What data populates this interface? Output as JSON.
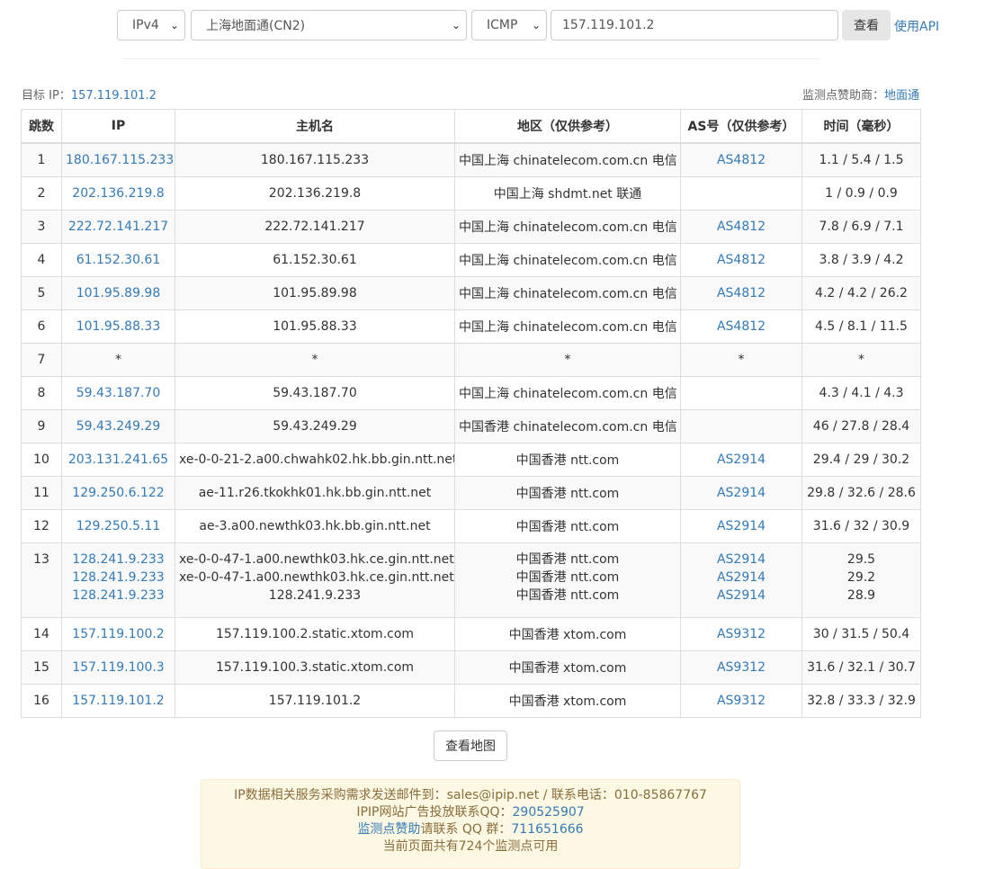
{
  "toolbar": {
    "ip_version": "IPv4",
    "node": "上海地面通(CN2)",
    "protocol": "ICMP",
    "target_value": "157.119.101.2",
    "query_label": "查看",
    "api_label": "使用API"
  },
  "info": {
    "target_label": "目标 IP：",
    "target_ip": "157.119.101.2",
    "sponsor_label": "监测点赞助商：",
    "sponsor_name": "地面通"
  },
  "table": {
    "headers": [
      "跳数",
      "IP",
      "主机名",
      "地区（仅供参考）",
      "AS号（仅供参考）",
      "时间（毫秒）"
    ],
    "rows": [
      {
        "hop": "1",
        "ip": "180.167.115.233",
        "host": "180.167.115.233",
        "region": "中国上海 chinatelecom.com.cn 电信",
        "asn": "AS4812",
        "time": "1.1 / 5.4 / 1.5"
      },
      {
        "hop": "2",
        "ip": "202.136.219.8",
        "host": "202.136.219.8",
        "region": "中国上海 shdmt.net 联通",
        "asn": "",
        "time": "1 / 0.9 / 0.9"
      },
      {
        "hop": "3",
        "ip": "222.72.141.217",
        "host": "222.72.141.217",
        "region": "中国上海 chinatelecom.com.cn 电信",
        "asn": "AS4812",
        "time": "7.8 / 6.9 / 7.1"
      },
      {
        "hop": "4",
        "ip": "61.152.30.61",
        "host": "61.152.30.61",
        "region": "中国上海 chinatelecom.com.cn 电信",
        "asn": "AS4812",
        "time": "3.8 / 3.9 / 4.2"
      },
      {
        "hop": "5",
        "ip": "101.95.89.98",
        "host": "101.95.89.98",
        "region": "中国上海 chinatelecom.com.cn 电信",
        "asn": "AS4812",
        "time": "4.2 / 4.2 / 26.2"
      },
      {
        "hop": "6",
        "ip": "101.95.88.33",
        "host": "101.95.88.33",
        "region": "中国上海 chinatelecom.com.cn 电信",
        "asn": "AS4812",
        "time": "4.5 / 8.1 / 11.5"
      },
      {
        "hop": "7",
        "ip": "*",
        "host": "*",
        "region": "*",
        "asn": "*",
        "time": "*"
      },
      {
        "hop": "8",
        "ip": "59.43.187.70",
        "host": "59.43.187.70",
        "region": "中国上海 chinatelecom.com.cn 电信",
        "asn": "",
        "time": "4.3 / 4.1 / 4.3"
      },
      {
        "hop": "9",
        "ip": "59.43.249.29",
        "host": "59.43.249.29",
        "region": "中国香港 chinatelecom.com.cn 电信",
        "asn": "",
        "time": "46 / 27.8 / 28.4"
      },
      {
        "hop": "10",
        "ip": "203.131.241.65",
        "host": "xe-0-0-21-2.a00.chwahk02.hk.bb.gin.ntt.net",
        "region": "中国香港 ntt.com",
        "asn": "AS2914",
        "time": "29.4 / 29 / 30.2"
      },
      {
        "hop": "11",
        "ip": "129.250.6.122",
        "host": "ae-11.r26.tkokhk01.hk.bb.gin.ntt.net",
        "region": "中国香港 ntt.com",
        "asn": "AS2914",
        "time": "29.8 / 32.6 / 28.6"
      },
      {
        "hop": "12",
        "ip": "129.250.5.11",
        "host": "ae-3.a00.newthk03.hk.bb.gin.ntt.net",
        "region": "中国香港 ntt.com",
        "asn": "AS2914",
        "time": "31.6 / 32 / 30.9"
      },
      {
        "hop": "13",
        "multi": [
          {
            "ip": "128.241.9.233",
            "host": "xe-0-0-47-1.a00.newthk03.hk.ce.gin.ntt.net",
            "region": "中国香港 ntt.com",
            "asn": "AS2914",
            "time": "29.5"
          },
          {
            "ip": "128.241.9.233",
            "host": "xe-0-0-47-1.a00.newthk03.hk.ce.gin.ntt.net",
            "region": "中国香港 ntt.com",
            "asn": "AS2914",
            "time": "29.2"
          },
          {
            "ip": "128.241.9.233",
            "host": "128.241.9.233",
            "region": "中国香港 ntt.com",
            "asn": "AS2914",
            "time": "28.9"
          }
        ]
      },
      {
        "hop": "14",
        "ip": "157.119.100.2",
        "host": "157.119.100.2.static.xtom.com",
        "region": "中国香港 xtom.com",
        "asn": "AS9312",
        "time": "30 / 31.5 / 50.4"
      },
      {
        "hop": "15",
        "ip": "157.119.100.3",
        "host": "157.119.100.3.static.xtom.com",
        "region": "中国香港 xtom.com",
        "asn": "AS9312",
        "time": "31.6 / 32.1 / 30.7"
      },
      {
        "hop": "16",
        "ip": "157.119.101.2",
        "host": "157.119.101.2",
        "region": "中国香港 xtom.com",
        "asn": "AS9312",
        "time": "32.8 / 33.3 / 32.9"
      }
    ]
  },
  "map_button": "查看地图",
  "footer": {
    "line1": "IP数据相关服务采购需求发送邮件到：sales@ipip.net / 联系电话：010-85867767",
    "line2_text": "IPIP网站广告投放联系QQ：",
    "line2_qq": "290525907",
    "line3_link": "监测点赞助",
    "line3_text": "请联系 QQ 群：",
    "line3_qq": "711651666",
    "line4": "当前页面共有724个监测点可用"
  },
  "colors": {
    "link": "#337ab7",
    "stripe": "#f9f9f9",
    "border": "#ddd",
    "footer_bg": "#fcf8e3",
    "footer_text": "#8a6d3b"
  }
}
